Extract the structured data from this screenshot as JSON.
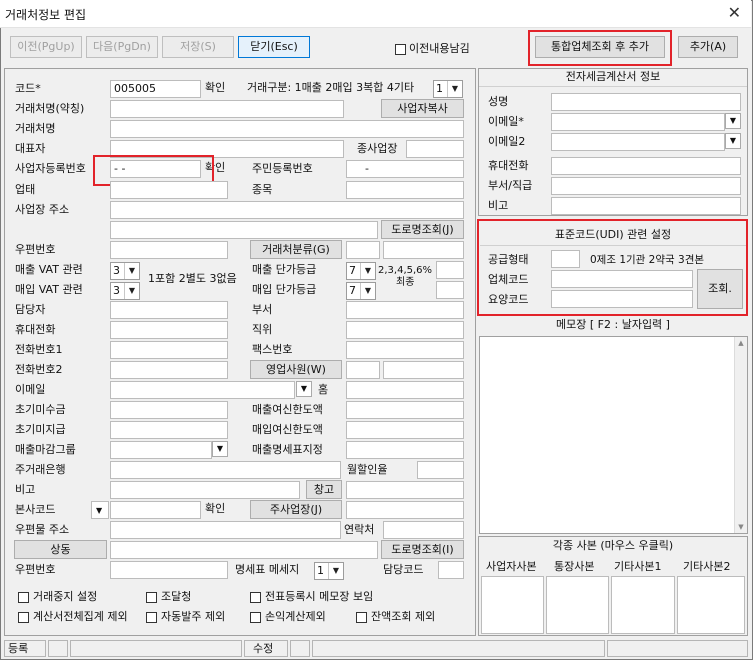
{
  "window": {
    "title": "거래처정보 편집",
    "close": "✕"
  },
  "toolbar": {
    "prev": "이전(PgUp)",
    "next": "다음(PgDn)",
    "save": "저장(S)",
    "close": "닫기(Esc)",
    "keep_label": "이전내용남김",
    "integrated_add": "통합업체조회 후 추가",
    "add": "추가(A)"
  },
  "left": {
    "code_label": "코드*",
    "code_value": "005005",
    "confirm": "확인",
    "trade_type_label": "거래구분: 1매출 2매입 3복합 4기타",
    "trade_type_value": "1",
    "name_short_label": "거래처명(약칭)",
    "biz_copy": "사업자복사",
    "name_label": "거래처명",
    "ceo_label": "대표자",
    "sub_biz_label": "종사업장",
    "bizno_label": "사업자등록번호",
    "bizno_value": " - -",
    "bizno_confirm": "확인",
    "resident_label": "주민등록번호",
    "resident_value": "-",
    "biztype_label": "업태",
    "item_label": "종목",
    "address_label": "사업장 주소",
    "road_search": "도로명조회(J)",
    "zip_label": "우편번호",
    "class_btn": "거래처분류(G)",
    "vat_sales_label": "매출 VAT 관련",
    "vat_sales_value": "3",
    "vat_note": "1포함 2별도 3없음",
    "vat_buy_label": "매입 VAT 관련",
    "vat_buy_value": "3",
    "price_sales_label": "매출 단가등급",
    "price_sales_value": "7",
    "price_note1": "2,3,4,5,6%",
    "price_note2": "최종",
    "price_buy_label": "매입 단가등급",
    "price_buy_value": "7",
    "manager_label": "담당자",
    "dept_label": "부서",
    "mobile_label": "휴대전화",
    "position_label": "직위",
    "phone1_label": "전화번호1",
    "fax_label": "팩스번호",
    "phone2_label": "전화번호2",
    "sales_rep_btn": "영업사원(W)",
    "email_label": "이메일",
    "home_label": "홈",
    "init_recv_label": "초기미수금",
    "sales_credit_label": "매출여신한도액",
    "init_pay_label": "초기미지급",
    "buy_credit_label": "매입여신한도액",
    "close_group_label": "매출마감그룹",
    "sales_stmt_label": "매출명세표지정",
    "bank_label": "주거래은행",
    "installment_label": "월할인율",
    "note_label": "비고",
    "warehouse_btn": "창고",
    "hq_label": "본사코드",
    "hq_confirm": "확인",
    "main_site_btn": "주사업장(J)",
    "mail_addr_label": "우편물 주소",
    "contact_label": "연락처",
    "same_btn": "상동",
    "road_search2": "도로명조회(I)",
    "zip2_label": "우편번호",
    "stmt_msg_label": "명세표 메세지",
    "stmt_msg_value": "1",
    "owner_code_label": "담당코드",
    "checks": [
      "거래중지 설정",
      "조달청",
      "전표등록시 메모장 보임",
      "계산서전체집계 제외",
      "자동발주 제외",
      "손익계산제외",
      "잔액조회 제외"
    ]
  },
  "right": {
    "einvoice_title": "전자세금계산서 정보",
    "name_label": "성명",
    "email_label": "이메일*",
    "email2_label": "이메일2",
    "mobile_label": "휴대전화",
    "dept_label": "부서/직급",
    "note_label": "비고",
    "udi_title": "표준코드(UDI) 관련 설정",
    "supply_label": "공급형태",
    "supply_note": "0제조 1기관 2약국 3견본",
    "company_code_label": "업체코드",
    "care_code_label": "요양코드",
    "lookup_btn": "조회.",
    "memo_title": "메모장 [ F2 : 날자입력 ]",
    "copies_title": "각종 사본 (마우스 우클릭)",
    "copies": [
      "사업자사본",
      "통장사본",
      "기타사본1",
      "기타사본2"
    ]
  },
  "statusbar": {
    "register": "등록",
    "modify": "수정"
  }
}
